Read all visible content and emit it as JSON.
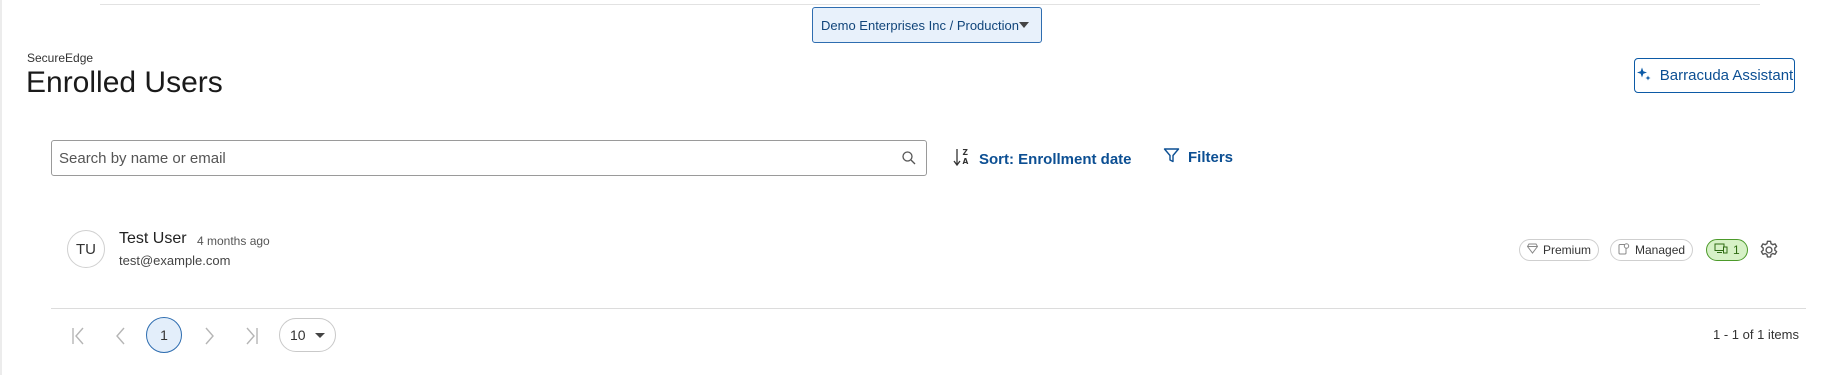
{
  "tenant_selector": {
    "label": "Demo Enterprises Inc / Production"
  },
  "header": {
    "app_name": "SecureEdge",
    "title": "Enrolled Users"
  },
  "assistant_button": {
    "label": "Barracuda Assistant"
  },
  "toolbar": {
    "search_placeholder": "Search by name or email",
    "sort_label": "Sort: Enrollment date",
    "filters_label": "Filters"
  },
  "users": [
    {
      "initials": "TU",
      "name": "Test User",
      "enrolled_ago": "4 months ago",
      "email": "test@example.com",
      "tags": [
        "Premium",
        "Managed"
      ],
      "device_count": "1"
    }
  ],
  "pagination": {
    "current_page": "1",
    "page_size": "10",
    "range_text": "1 - 1 of 1 items"
  },
  "icons": {
    "tenant": "chevron-down-icon",
    "assistant": "sparkle-icon",
    "search": "search-icon",
    "sort": "sort-az-icon",
    "filters": "filter-icon",
    "premium": "diamond-icon",
    "managed": "managed-device-icon",
    "devices": "devices-icon",
    "settings": "gear-icon"
  },
  "colors": {
    "accent": "#0c4f93",
    "selector_bg": "#e8f1fb",
    "device_badge_bg": "#d6f1c6",
    "device_badge_border": "#4c9a2a"
  }
}
